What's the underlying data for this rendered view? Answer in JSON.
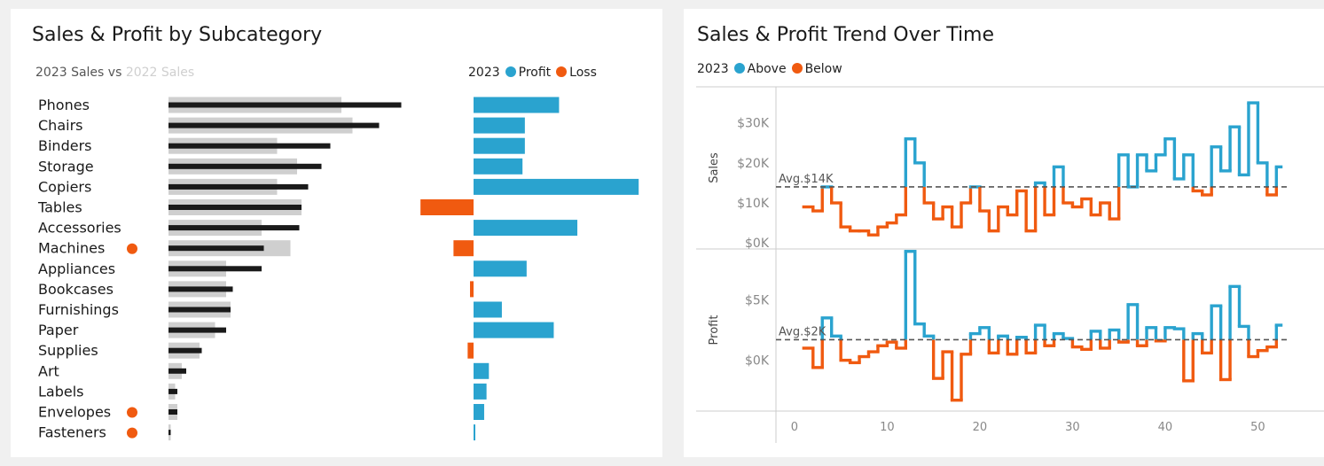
{
  "colors": {
    "above": "#2aa3cf",
    "below": "#f05a10",
    "y2023": "#1a1a1a",
    "y2022": "#cfcfcf",
    "grid": "#cccccc"
  },
  "left": {
    "title": "Sales & Profit  by Subcategory",
    "legend_prefix": "2023 Sales vs",
    "legend_2022": "2022 Sales",
    "profit_legend": {
      "year": "2023",
      "profit": "Profit",
      "loss": "Loss"
    }
  },
  "right": {
    "title": "Sales & Profit Trend Over Time",
    "legend": {
      "year": "2023",
      "above": "Above",
      "below": "Below"
    }
  },
  "chart_data": [
    {
      "type": "bar",
      "title": "Sales & Profit  by Subcategory",
      "categories": [
        "Phones",
        "Chairs",
        "Binders",
        "Storage",
        "Copiers",
        "Tables",
        "Accessories",
        "Machines",
        "Appliances",
        "Bookcases",
        "Furnishings",
        "Paper",
        "Supplies",
        "Art",
        "Labels",
        "Envelopes",
        "Fasteners"
      ],
      "flagged": [
        "Machines",
        "Envelopes",
        "Fasteners"
      ],
      "series": [
        {
          "name": "2023 Sales",
          "values": [
            105,
            95,
            73,
            69,
            63,
            60,
            59,
            43,
            42,
            29,
            28,
            26,
            15,
            8,
            4,
            4,
            1
          ]
        },
        {
          "name": "2022 Sales",
          "values": [
            78,
            83,
            49,
            58,
            49,
            60,
            42,
            55,
            26,
            26,
            28,
            21,
            14,
            6,
            3,
            4,
            1
          ]
        },
        {
          "name": "Profit",
          "values": [
            14.5,
            8.7,
            8.7,
            8.3,
            28,
            -9,
            17.6,
            -3.4,
            9,
            -0.6,
            4.8,
            13.6,
            -1,
            2.6,
            2.2,
            1.8,
            0.3
          ]
        }
      ]
    },
    {
      "type": "line",
      "title": "Sales & Profit Trend Over Time",
      "x": [
        1,
        2,
        3,
        4,
        5,
        6,
        7,
        8,
        9,
        10,
        11,
        12,
        13,
        14,
        15,
        16,
        17,
        18,
        19,
        20,
        21,
        22,
        23,
        24,
        25,
        26,
        27,
        28,
        29,
        30,
        31,
        32,
        33,
        34,
        35,
        36,
        37,
        38,
        39,
        40,
        41,
        42,
        43,
        44,
        45,
        46,
        47,
        48,
        49,
        50,
        51,
        52
      ],
      "x_ticks": [
        0,
        10,
        20,
        30,
        40,
        50
      ],
      "panels": [
        {
          "ylabel": "Sales",
          "y_ticks": [
            {
              "v": 0,
              "label": "$0K"
            },
            {
              "v": 10,
              "label": "$10K"
            },
            {
              "v": 20,
              "label": "$20K"
            },
            {
              "v": 30,
              "label": "$30K"
            }
          ],
          "ylim": [
            -1.5,
            39
          ],
          "avg": 14,
          "avg_label": "Avg.$14K",
          "values": [
            9,
            8,
            14,
            10,
            4,
            3,
            3,
            2,
            4,
            5,
            7,
            26,
            20,
            10,
            6,
            9,
            4,
            10,
            14,
            8,
            3,
            9,
            7,
            13,
            3,
            15,
            7,
            19,
            10,
            9,
            11,
            7,
            10,
            6,
            22,
            14,
            22,
            18,
            22,
            26,
            16,
            22,
            13,
            12,
            24,
            18,
            29,
            17,
            35,
            20,
            12,
            19
          ]
        },
        {
          "ylabel": "Profit",
          "y_ticks": [
            {
              "v": 0,
              "label": "$0K"
            },
            {
              "v": 5,
              "label": "$5K"
            }
          ],
          "ylim": [
            -4.2,
            9.2
          ],
          "avg": 1.7,
          "avg_label": "Avg.$2K",
          "values": [
            1,
            -0.6,
            3.5,
            2,
            0,
            -0.2,
            0.3,
            0.7,
            1.2,
            1.5,
            1,
            9,
            3,
            2,
            -1.5,
            0.7,
            -3.3,
            0.5,
            2.2,
            2.7,
            0.6,
            2,
            0.5,
            1.9,
            0.6,
            2.9,
            1.2,
            2.2,
            1.8,
            1.1,
            0.9,
            2.4,
            1,
            2.5,
            1.5,
            4.6,
            1.2,
            2.7,
            1.6,
            2.7,
            2.6,
            -1.7,
            2.2,
            0.6,
            4.5,
            -1.6,
            6.1,
            2.8,
            0.3,
            0.8,
            1.1,
            2.9
          ]
        }
      ]
    }
  ]
}
